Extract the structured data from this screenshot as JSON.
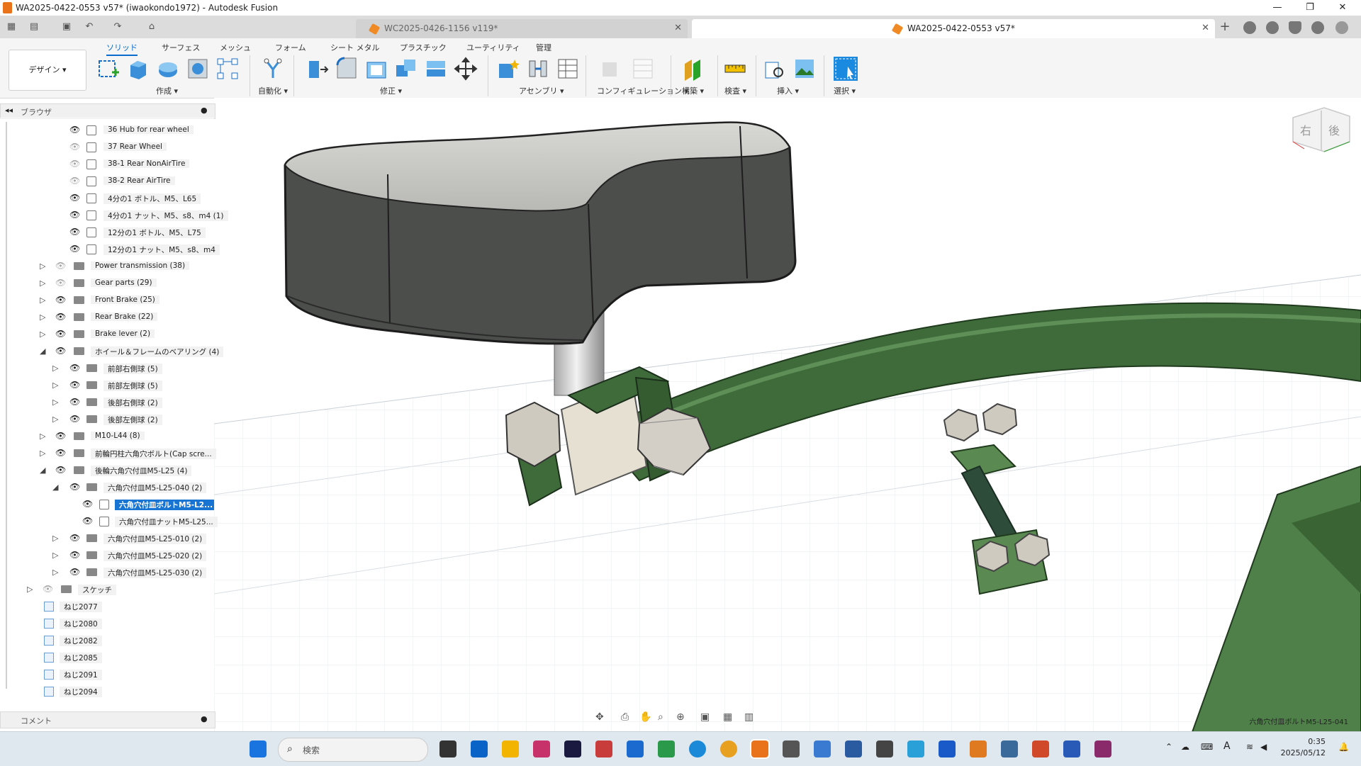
{
  "window": {
    "title": "WA2025-0422-0553 v57* (iwaokondo1972) - Autodesk Fusion",
    "min": "—",
    "max": "❐",
    "close": "✕"
  },
  "tabs": [
    {
      "label": "WC2025-0426-1156 v119*",
      "active": false
    },
    {
      "label": "WA2025-0422-0553 v57*",
      "active": true
    }
  ],
  "ribbon": {
    "design_label": "デザイン ▾",
    "tabs": [
      "ソリッド",
      "サーフェス",
      "メッシュ",
      "フォーム",
      "シート メタル",
      "プラスチック",
      "ユーティリティ",
      "管理"
    ],
    "groups": [
      "作成 ▾",
      "自動化 ▾",
      "修正 ▾",
      "アセンブリ ▾",
      "コンフィギュレーション ▾",
      "構築 ▾",
      "検査 ▾",
      "挿入 ▾",
      "選択 ▾"
    ]
  },
  "browser": {
    "header": "ブラウザ",
    "items": [
      "36 Hub for rear wheel",
      "37 Rear Wheel",
      "38-1 Rear NonAirTire",
      "38-2 Rear AirTire",
      "4分の1 ボトル、M5、L65",
      "4分の1 ナット、M5、s8、m4 (1)",
      "12分の1 ボトル、M5、L75",
      "12分の1 ナット、M5、s8、m4",
      "Power transmission (38)",
      "Gear parts (29)",
      "Front Brake (25)",
      "Rear Brake (22)",
      "Brake lever (2)",
      "ホイール＆フレームのベアリング (4)",
      "前部右側球 (5)",
      "前部左側球 (5)",
      "後部右側球 (2)",
      "後部左側球 (2)",
      "M10-L44 (8)",
      "前輪円柱六角穴ボルト(Cap scre...",
      "後輪六角穴付皿M5-L25 (4)",
      "六角穴付皿M5-L25-040 (2)",
      "六角穴付皿ボルトM5-L2...",
      "六角穴付皿ナットM5-L25...",
      "六角穴付皿M5-L25-010 (2)",
      "六角穴付皿M5-L25-020 (2)",
      "六角穴付皿M5-L25-030 (2)",
      "スケッチ",
      "ねじ2077",
      "ねじ2080",
      "ねじ2082",
      "ねじ2085",
      "ねじ2091",
      "ねじ2094"
    ],
    "comment": "コメント"
  },
  "viewcube": {
    "right": "右",
    "back": "後"
  },
  "status_text": "六角穴付皿ボルトM5-L25-041",
  "taskbar": {
    "search_placeholder": "検索",
    "time": "0:35",
    "date": "2025/05/12",
    "ime": "A"
  },
  "colors": {
    "accent": "#1874d2",
    "frame_green": "#3f6b3b",
    "seat_dark": "#4a4c4a"
  }
}
